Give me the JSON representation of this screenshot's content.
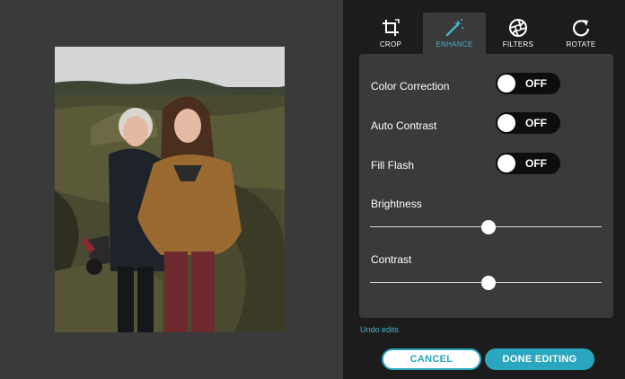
{
  "tabs": [
    {
      "label": "CROP",
      "icon": "crop-icon",
      "active": false
    },
    {
      "label": "ENHANCE",
      "icon": "magic-wand-icon",
      "active": true
    },
    {
      "label": "FILTERS",
      "icon": "aperture-icon",
      "active": false
    },
    {
      "label": "ROTATE",
      "icon": "rotate-icon",
      "active": false
    }
  ],
  "enhance": {
    "color_correction": {
      "label": "Color Correction",
      "state": "OFF"
    },
    "auto_contrast": {
      "label": "Auto Contrast",
      "state": "OFF"
    },
    "fill_flash": {
      "label": "Fill Flash",
      "state": "OFF"
    },
    "brightness": {
      "label": "Brightness",
      "value": 0.51
    },
    "contrast": {
      "label": "Contrast",
      "value": 0.51
    }
  },
  "actions": {
    "undo_label": "Undo edits",
    "cancel_label": "CANCEL",
    "done_label": "DONE EDITING"
  },
  "colors": {
    "accent": "#2aa6bf",
    "panel_bg": "#1c1c1c",
    "card_bg": "#3a3a3a"
  }
}
